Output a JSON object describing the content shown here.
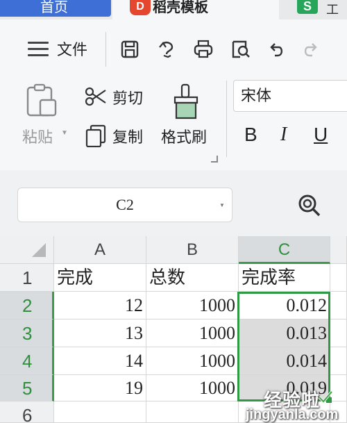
{
  "tabs": [
    {
      "label": "首页"
    },
    {
      "label": "稻壳模板",
      "icon_text": "D"
    },
    {
      "icon_text": "S",
      "label": "工"
    }
  ],
  "menu": {
    "file_label": "文件"
  },
  "quick_toolbar": [
    "save-icon",
    "revert-icon",
    "print-icon",
    "print-preview-icon",
    "undo-icon",
    "redo-icon"
  ],
  "clipboard": {
    "paste_label": "粘贴",
    "cut_label": "剪切",
    "copy_label": "复制",
    "format_painter_label": "格式刷"
  },
  "font": {
    "name": "宋体",
    "bold_label": "B",
    "italic_label": "I",
    "underline_label": "U"
  },
  "name_box": {
    "value": "C2"
  },
  "grid": {
    "columns": [
      "A",
      "B",
      "C"
    ],
    "row_numbers": [
      "1",
      "2",
      "3",
      "4",
      "5",
      "6"
    ],
    "header_row": [
      "完成",
      "总数",
      "完成率"
    ],
    "rows": [
      [
        "12",
        "1000",
        "0.012"
      ],
      [
        "13",
        "1000",
        "0.013"
      ],
      [
        "14",
        "1000",
        "0.014"
      ],
      [
        "19",
        "1000",
        "0.019"
      ]
    ]
  },
  "watermark": {
    "top": "经验啦",
    "bottom": "jingyanla.com"
  },
  "colors": {
    "accent_green": "#2e9a43",
    "tab_blue": "#3e6fd6",
    "brand_red": "#e5462e"
  }
}
